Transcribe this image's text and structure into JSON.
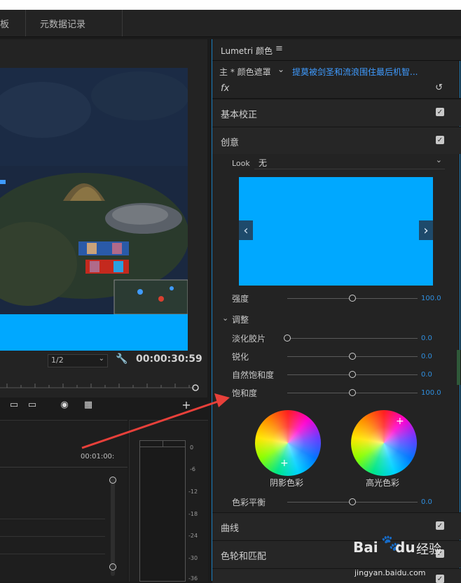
{
  "header": {
    "tab_partial": "板",
    "tab_metadata": "元数据记录"
  },
  "monitor": {
    "resolution": "1/2",
    "timecode": "00:00:30:59"
  },
  "timeline": {
    "timecode": "00:01:00:"
  },
  "meter": {
    "ticks": [
      "0",
      "-6",
      "-12",
      "-18",
      "-24",
      "-30",
      "-36"
    ]
  },
  "lumetri": {
    "title": "Lumetri 颜色",
    "menu_icon": "≡",
    "master_label": "主 * 颜色遮罩",
    "clip_name": "提莫被剑圣和流浪围住最后机智...",
    "fx_label": "fx",
    "sections": {
      "basic": "基本校正",
      "creative": "创意",
      "curves": "曲线",
      "wheels_match": "色轮和匹配"
    },
    "look": {
      "label": "Look",
      "value": "无"
    },
    "intensity": {
      "label": "强度",
      "value": "100.0",
      "fraction": 0.5
    },
    "adjustments": {
      "label": "调整",
      "faded_film": {
        "label": "淡化胶片",
        "value": "0.0",
        "fraction": 0.0
      },
      "sharpen": {
        "label": "锐化",
        "value": "0.0",
        "fraction": 0.5
      },
      "vibrance": {
        "label": "自然饱和度",
        "value": "0.0",
        "fraction": 0.5
      },
      "saturation": {
        "label": "饱和度",
        "value": "100.0",
        "fraction": 0.5
      }
    },
    "shadow_tint": "阴影色彩",
    "highlight_tint": "高光色彩",
    "tint_balance": {
      "label": "色彩平衡",
      "value": "0.0",
      "fraction": 0.5
    }
  },
  "watermark": {
    "brand": "Bai",
    "brand2": "du",
    "jingyan": "经验",
    "url": "jingyan.baidu.com"
  },
  "colors": {
    "accent_blue": "#00a8ff",
    "value_blue": "#2f8fe0",
    "clip_name_blue": "#3f9bff",
    "arrow_red": "#e8403a"
  }
}
